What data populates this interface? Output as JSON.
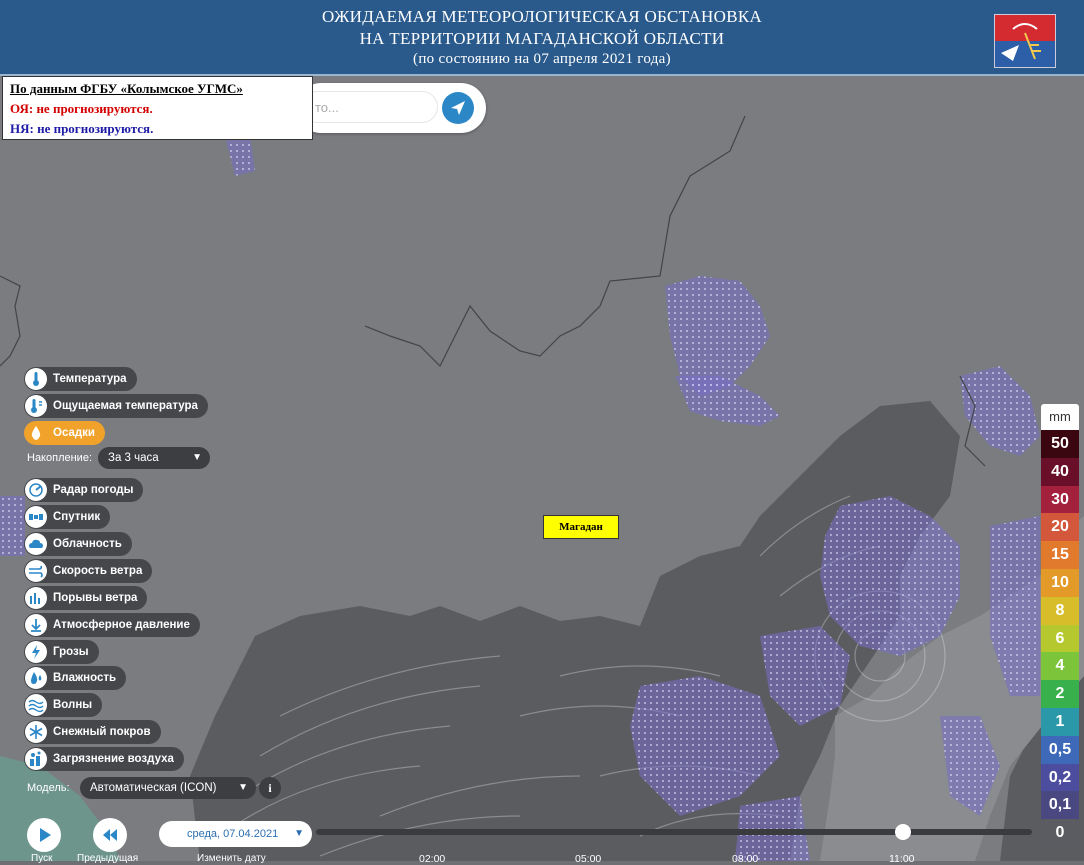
{
  "header": {
    "line1": "ОЖИДАЕМАЯ МЕТЕОРОЛОГИЧЕСКАЯ  ОБСТАНОВКА",
    "line2": "НА  ТЕРРИТОРИИ МАГАДАНСКОЙ  ОБЛАСТИ",
    "line3": "(по состоянию на 07 апреля 2021 года)"
  },
  "info": {
    "source": "По данным ФГБУ «Колымское УГМС»",
    "oya_label": "ОЯ",
    "oya_text": ": не прогнозируются.",
    "nya_label": "НЯ",
    "nya_text": ": не прогнозируются."
  },
  "search": {
    "placeholder": "то..."
  },
  "layers": [
    {
      "label": "Температура",
      "icon": "thermometer-icon"
    },
    {
      "label": "Ощущаемая температура",
      "icon": "feels-like-icon"
    },
    {
      "label": "Осадки",
      "icon": "precipitation-icon",
      "active": true
    },
    {
      "label": "Радар погоды",
      "icon": "radar-icon"
    },
    {
      "label": "Спутник",
      "icon": "satellite-icon"
    },
    {
      "label": "Облачность",
      "icon": "cloud-icon"
    },
    {
      "label": "Скорость ветра",
      "icon": "wind-icon"
    },
    {
      "label": "Порывы ветра",
      "icon": "gust-icon"
    },
    {
      "label": "Атмосферное давление",
      "icon": "pressure-icon"
    },
    {
      "label": "Грозы",
      "icon": "thunder-icon"
    },
    {
      "label": "Влажность",
      "icon": "humidity-icon"
    },
    {
      "label": "Волны",
      "icon": "waves-icon"
    },
    {
      "label": "Снежный покров",
      "icon": "snowflake-icon"
    },
    {
      "label": "Загрязнение воздуха",
      "icon": "pollution-icon"
    }
  ],
  "accumulation": {
    "label": "Накопление:",
    "value": "За 3 часа"
  },
  "model": {
    "label": "Модель:",
    "value": "Автоматическая (ICON)",
    "info": "i"
  },
  "timeline": {
    "date": "среда, 07.04.2021",
    "ticks": [
      "02:00",
      "05:00",
      "08:00",
      "11:00"
    ],
    "progress": 0.82
  },
  "bottom_labels": {
    "play": "Пуск",
    "prev": "Предыдущая",
    "change": "Изменить дату"
  },
  "city": "Магадан",
  "legend": {
    "unit": "mm",
    "steps": [
      {
        "value": "50",
        "color": "#3a0610"
      },
      {
        "value": "40",
        "color": "#6a0f2a"
      },
      {
        "value": "30",
        "color": "#a3213d"
      },
      {
        "value": "20",
        "color": "#d2573b"
      },
      {
        "value": "15",
        "color": "#e27a2d"
      },
      {
        "value": "10",
        "color": "#e39a28"
      },
      {
        "value": "8",
        "color": "#d6bd29"
      },
      {
        "value": "6",
        "color": "#b5c92f"
      },
      {
        "value": "4",
        "color": "#7cc43a"
      },
      {
        "value": "2",
        "color": "#38b04b"
      },
      {
        "value": "1",
        "color": "#2a98a8"
      },
      {
        "value": "0,5",
        "color": "#3d69b8"
      },
      {
        "value": "0,2",
        "color": "#4c4d9e"
      },
      {
        "value": "0,1",
        "color": "#4a4880"
      },
      {
        "value": "0",
        "color": "#5b5c61"
      }
    ]
  },
  "colors": {
    "header_bg": "#2a5a8c",
    "accent": "#f0a22a",
    "button_blue": "#2c87c7",
    "oya": "#d40000",
    "nya": "#1d1ba5"
  }
}
